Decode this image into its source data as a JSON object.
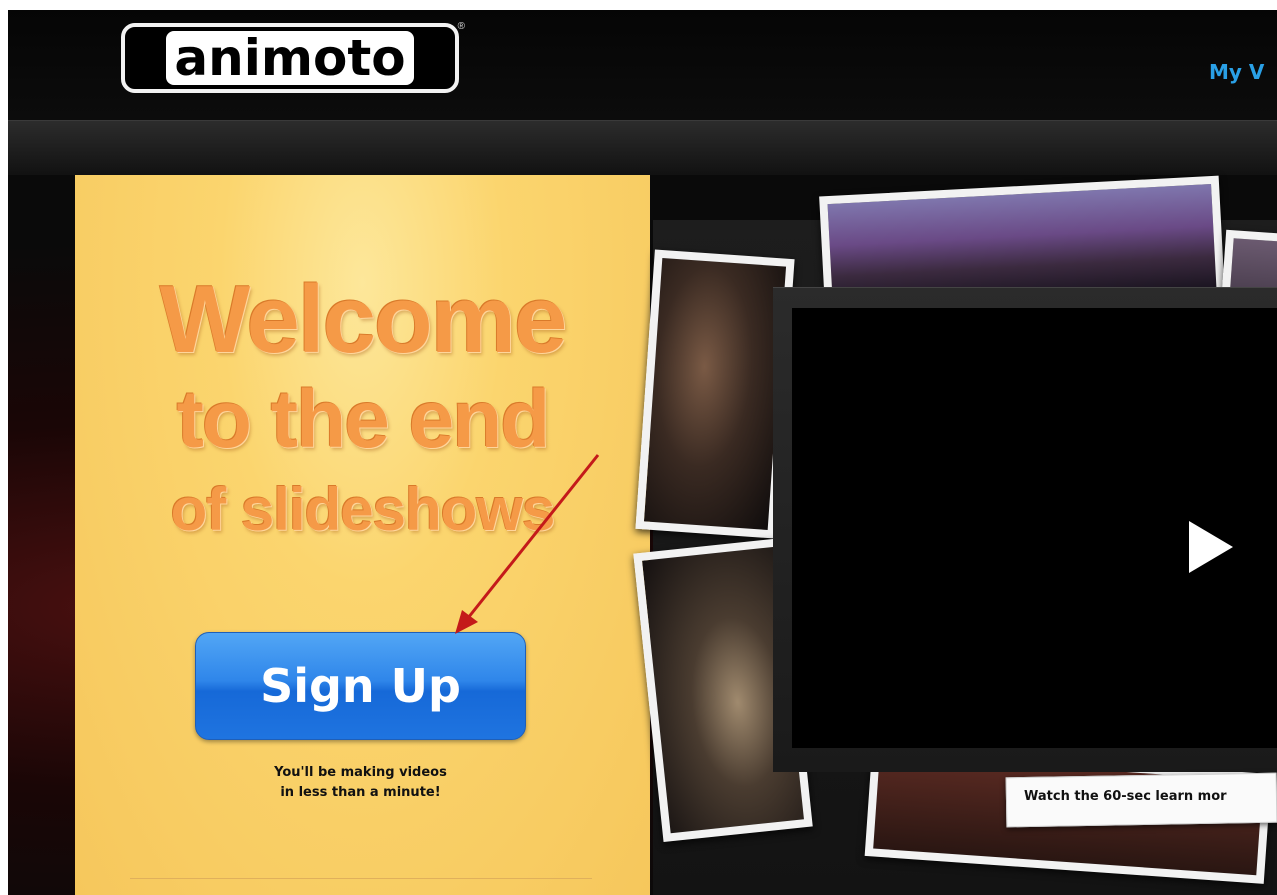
{
  "header": {
    "logo_text": "animoto",
    "logo_reg": "®",
    "nav_link": "My V"
  },
  "hero": {
    "headline_line1": "Welcome",
    "headline_line2": "to the end",
    "headline_line3": "of slideshows",
    "signup_label": "Sign Up",
    "tagline_line1": "You'll be making videos",
    "tagline_line2": "in less than a minute!"
  },
  "video": {
    "play_icon": "play-icon",
    "learn_more": "Watch the 60-sec learn mor"
  },
  "colors": {
    "accent_blue": "#2f86ea",
    "headline_orange": "#f59a47",
    "panel_yellow": "#fbd56e",
    "link_blue": "#2aa0e6",
    "annotation_arrow": "#c41a1a"
  }
}
